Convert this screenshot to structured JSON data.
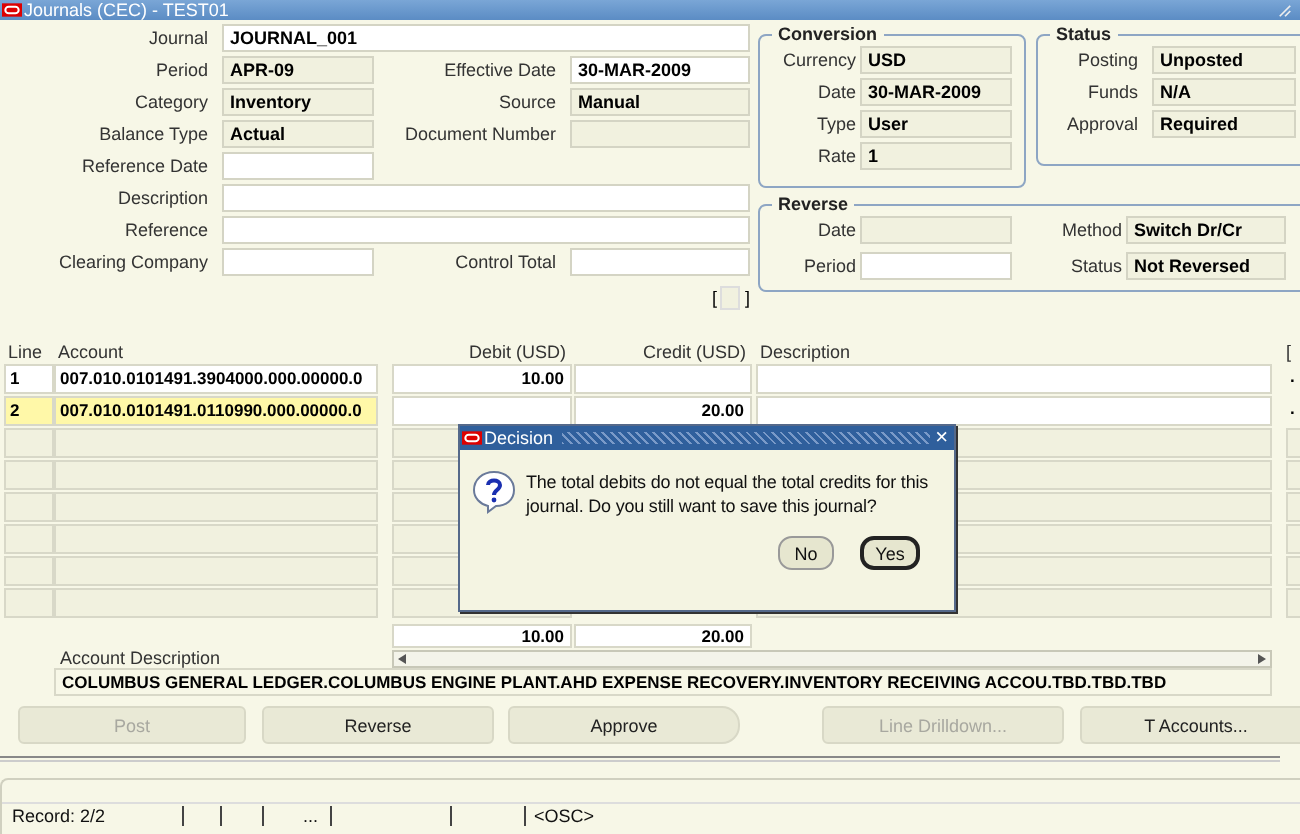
{
  "window": {
    "title": "Journals (CEC) - TEST01"
  },
  "journal_form": [
    [
      {
        "label": "Journal",
        "value": "JOURNAL_001",
        "readonly": false,
        "wide": true
      }
    ],
    [
      {
        "label": "Period",
        "value": "APR-09",
        "readonly": true
      },
      {
        "label": "Effective Date",
        "value": "30-MAR-2009",
        "readonly": false
      }
    ],
    [
      {
        "label": "Category",
        "value": "Inventory",
        "readonly": true
      },
      {
        "label": "Source",
        "value": "Manual",
        "readonly": true
      }
    ],
    [
      {
        "label": "Balance Type",
        "value": "Actual",
        "readonly": true
      },
      {
        "label": "Document Number",
        "readonly": true
      }
    ],
    [
      {
        "label": "Reference Date",
        "readonly": false
      }
    ],
    [
      {
        "label": "Description",
        "readonly": false,
        "wide": true
      }
    ],
    [
      {
        "label": "Reference",
        "readonly": false,
        "wide": true
      }
    ],
    [
      {
        "label": "Clearing Company",
        "readonly": false
      },
      {
        "label": "Control Total",
        "readonly": false
      }
    ]
  ],
  "context_field": {
    "open": "[",
    "close": "]"
  },
  "conversion": {
    "title": "Conversion",
    "fields": [
      {
        "label": "Currency",
        "value": "USD",
        "readonly": true
      },
      {
        "label": "Date",
        "value": "30-MAR-2009",
        "readonly": true
      },
      {
        "label": "Type",
        "value": "User",
        "readonly": true
      },
      {
        "label": "Rate",
        "value": "1",
        "readonly": true
      }
    ]
  },
  "status": {
    "title": "Status",
    "fields": [
      {
        "label": "Posting",
        "value": "Unposted",
        "readonly": true
      },
      {
        "label": "Funds",
        "value": "N/A",
        "readonly": true
      },
      {
        "label": "Approval",
        "value": "Required",
        "readonly": true
      }
    ]
  },
  "reverse": {
    "title": "Reverse",
    "fields": [
      {
        "label": "Date",
        "readonly": true
      },
      {
        "label": "Method",
        "value": "Switch Dr/Cr",
        "readonly": true
      },
      {
        "label": "Period",
        "readonly": false
      },
      {
        "label": "Status",
        "value": "Not Reversed",
        "readonly": true
      }
    ]
  },
  "lines": {
    "columns": [
      "Line",
      "Account",
      "Debit (USD)",
      "Credit (USD)",
      "Description",
      "["
    ],
    "rows": [
      {
        "kind": "entry",
        "line": "1",
        "account": "007.010.0101491.3904000.000.00000.0",
        "debit": "10.00",
        "marker": ".",
        "selected": false
      },
      {
        "kind": "entry",
        "line": "2",
        "account": "007.010.0101491.0110990.000.00000.0",
        "credit": "20.00",
        "marker": ".",
        "selected": true
      },
      {
        "kind": "blank",
        "selected": false
      },
      {
        "kind": "blank",
        "selected": false
      },
      {
        "kind": "blank",
        "selected": false
      },
      {
        "kind": "blank",
        "selected": false
      },
      {
        "kind": "blank",
        "selected": false
      },
      {
        "kind": "blank",
        "selected": false
      }
    ],
    "totals": {
      "debit": "10.00",
      "credit": "20.00"
    }
  },
  "account_description": {
    "label": "Account Description",
    "value": "COLUMBUS GENERAL LEDGER.COLUMBUS ENGINE PLANT.AHD EXPENSE RECOVERY.INVENTORY RECEIVING ACCOU.TBD.TBD.TBD"
  },
  "buttons": [
    {
      "label": "Post",
      "disabled": true
    },
    {
      "label": "Reverse",
      "disabled": false
    },
    {
      "label": "Approve",
      "disabled": false
    },
    {
      "label": "Line Drilldown...",
      "disabled": true
    },
    {
      "label": "T Accounts...",
      "disabled": false
    }
  ],
  "status_bar": {
    "record": "Record: 2/2",
    "segment_4": "...",
    "segment_7": "<OSC>"
  },
  "dialog": {
    "title": "Decision",
    "close": "×",
    "message": "The total debits do not equal the total credits for this journal.  Do you still want to save this journal?",
    "buttons": [
      {
        "label": "No",
        "default": false
      },
      {
        "label": "Yes",
        "default": true
      }
    ]
  }
}
